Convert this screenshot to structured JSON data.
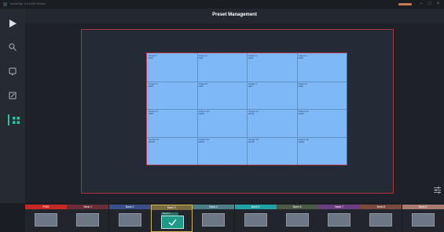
{
  "window": {
    "app_title": "NovaStar VX1000 Series",
    "user_badge_color": "#c77a4c",
    "minimize_label": "–",
    "restore_label": "□",
    "close_label": "×"
  },
  "header": {
    "title": "Preset Management"
  },
  "sidebar": {
    "items": [
      {
        "name": "play",
        "icon": "play-icon",
        "active": false
      },
      {
        "name": "search",
        "icon": "search-icon",
        "active": false
      },
      {
        "name": "monitor",
        "icon": "monitor-icon",
        "active": false
      },
      {
        "name": "edit",
        "icon": "edit-icon",
        "active": false
      },
      {
        "name": "preset",
        "icon": "grid-icon",
        "active": true
      }
    ],
    "accent_color": "#2cc3a6"
  },
  "screen": {
    "columns": 4,
    "rows": 4,
    "fill_color": "#7fb8f6",
    "border_color": "#b63a49",
    "cells": [
      {
        "name": "Output 1",
        "sub": "HD1"
      },
      {
        "name": "Output 2",
        "sub": "HD2"
      },
      {
        "name": "Output 3",
        "sub": "HD3"
      },
      {
        "name": "Output 4",
        "sub": "HD4"
      },
      {
        "name": "Output 5",
        "sub": "HD5"
      },
      {
        "name": "Output 6",
        "sub": "HD6"
      },
      {
        "name": "Output 7",
        "sub": "HD7"
      },
      {
        "name": "Output 8",
        "sub": "HD8"
      },
      {
        "name": "Output 9",
        "sub": "HD9"
      },
      {
        "name": "Output 10",
        "sub": "HD10"
      },
      {
        "name": "Output 11",
        "sub": "HD11"
      },
      {
        "name": "Output 12",
        "sub": "HD12"
      },
      {
        "name": "Output 13",
        "sub": "HD13"
      },
      {
        "name": "Output 14",
        "sub": "HD14"
      },
      {
        "name": "Output 15",
        "sub": "HD15"
      },
      {
        "name": "Output 16",
        "sub": "HD16"
      }
    ]
  },
  "banks": [
    {
      "label": "PGM",
      "color": "#c62828"
    },
    {
      "label": "Bank 1",
      "color": "#6b2d3a"
    },
    {
      "label": "Bank 2",
      "color": "#3a4f8a"
    },
    {
      "label": "Bank 3",
      "color": "#7a6b3c",
      "selected": true,
      "tag": "Preset 3"
    },
    {
      "label": "Bank 4",
      "color": "#4b7f85"
    },
    {
      "label": "Bank 5",
      "color": "#1fa3a6"
    },
    {
      "label": "Bank 6",
      "color": "#4c5b45"
    },
    {
      "label": "Bank 7",
      "color": "#6a3e80"
    },
    {
      "label": "Bank 8",
      "color": "#7a4a3e"
    },
    {
      "label": "Bank 9",
      "color": "#a87a70"
    }
  ]
}
